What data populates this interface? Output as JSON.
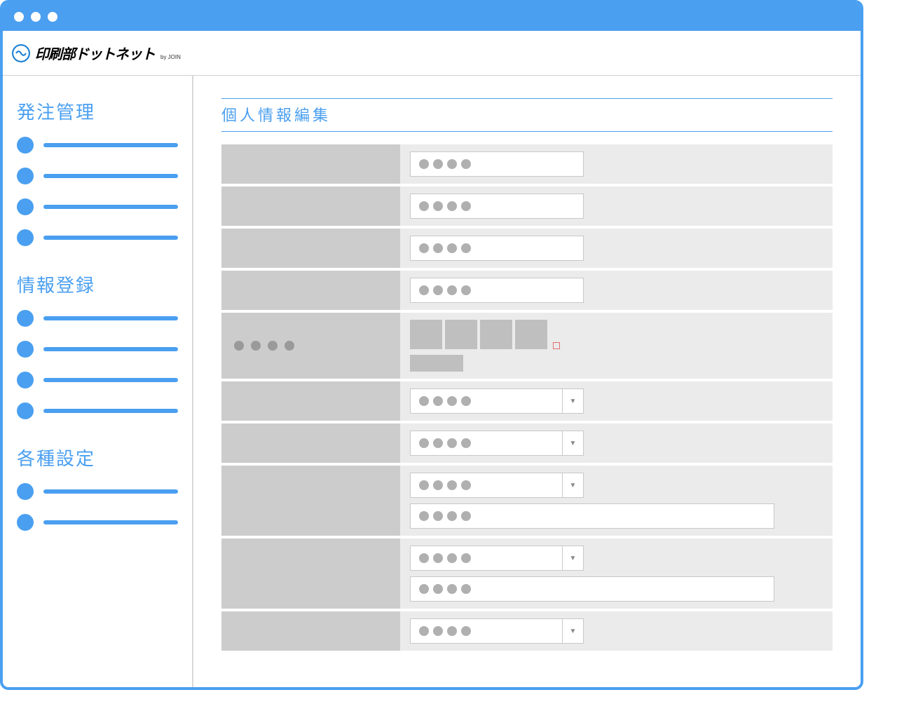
{
  "header": {
    "logo_text": "印刷部ドットネット",
    "logo_sub": "by JOIN"
  },
  "sidebar": {
    "sections": [
      {
        "heading": "発注管理",
        "item_count": 4
      },
      {
        "heading": "情報登録",
        "item_count": 4
      },
      {
        "heading": "各種設定",
        "item_count": 2
      }
    ]
  },
  "main": {
    "page_title": "個人情報編集",
    "form_rows": [
      {
        "type": "text",
        "label_dots": 0,
        "width": "normal"
      },
      {
        "type": "text",
        "label_dots": 0,
        "width": "normal"
      },
      {
        "type": "text",
        "label_dots": 0,
        "width": "normal"
      },
      {
        "type": "text",
        "label_dots": 0,
        "width": "normal"
      },
      {
        "type": "upload",
        "label_dots": 4
      },
      {
        "type": "select",
        "label_dots": 0
      },
      {
        "type": "select",
        "label_dots": 0
      },
      {
        "type": "select_text",
        "label_dots": 0
      },
      {
        "type": "select_text",
        "label_dots": 0
      },
      {
        "type": "select",
        "label_dots": 0
      }
    ]
  }
}
